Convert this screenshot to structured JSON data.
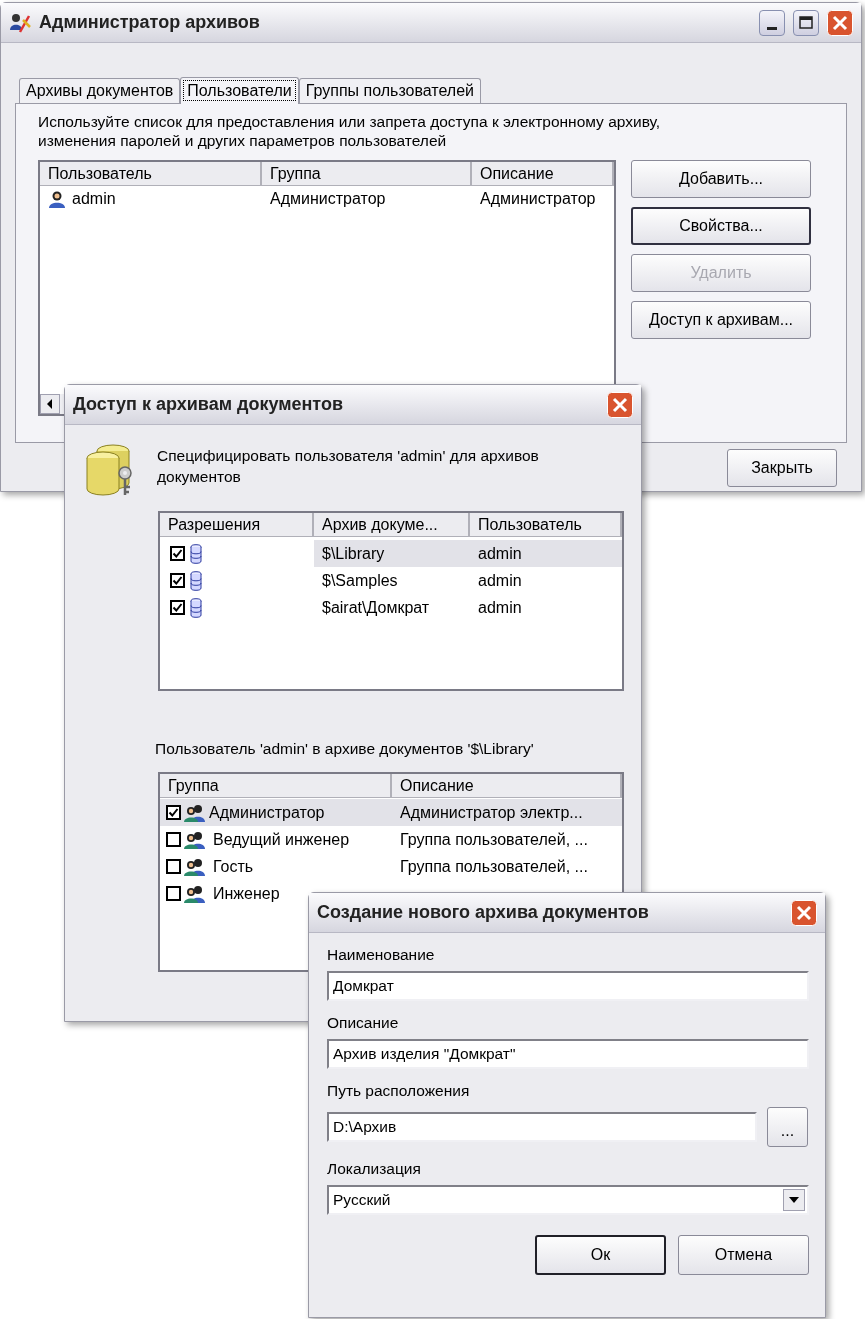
{
  "main_window": {
    "title": "Администратор архивов",
    "tabs": [
      {
        "label": "Архивы документов",
        "selected": false
      },
      {
        "label": "Пользователи",
        "selected": true
      },
      {
        "label": "Группы пользователей",
        "selected": false
      }
    ],
    "instruction": "Используйте список для предоставления или запрета доступа к электронному архиву, изменения паролей и других параметров пользователей",
    "users_table": {
      "columns": [
        "Пользователь",
        "Группа",
        "Описание"
      ],
      "rows": [
        {
          "cells": [
            "admin",
            "Администратор",
            "Администратор"
          ]
        }
      ]
    },
    "buttons": [
      {
        "label": "Добавить...",
        "disabled": false,
        "default": false
      },
      {
        "label": "Свойства...",
        "disabled": false,
        "default": true
      },
      {
        "label": "Удалить",
        "disabled": true,
        "default": false
      },
      {
        "label": "Доступ к архивам...",
        "disabled": false,
        "default": false
      }
    ],
    "close_button": "Закрыть"
  },
  "access_dialog": {
    "title": "Доступ к архивам документов",
    "prompt": "Специфицировать пользователя 'admin' для архивов документов",
    "archives_table": {
      "columns": [
        "Разрешения",
        "Архив докуме...",
        "Пользователь"
      ],
      "rows": [
        {
          "checked": true,
          "selected": true,
          "archive": "$\\Library",
          "user": "admin"
        },
        {
          "checked": true,
          "selected": false,
          "archive": "$\\Samples",
          "user": "admin"
        },
        {
          "checked": true,
          "selected": false,
          "archive": "$airat\\Домкрат",
          "user": "admin"
        }
      ]
    },
    "groups_label": "Пользователь 'admin' в архиве документов '$\\Library'",
    "groups_table": {
      "columns": [
        "Группа",
        "Описание"
      ],
      "rows": [
        {
          "checked": true,
          "selected": true,
          "name": "Администратор",
          "description": "Администратор электр..."
        },
        {
          "checked": false,
          "selected": false,
          "name": "Ведущий инженер",
          "description": "Группа пользователей, ..."
        },
        {
          "checked": false,
          "selected": false,
          "name": "Гость",
          "description": "Группа пользователей, ..."
        },
        {
          "checked": false,
          "selected": false,
          "name": "Инженер"
        }
      ]
    }
  },
  "create_dialog": {
    "title": "Создание нового архива документов",
    "fields": [
      {
        "kind": "text",
        "label": "Наименование",
        "value": "Домкрат"
      },
      {
        "kind": "text",
        "label": "Описание",
        "value": "Архив изделия \"Домкрат\""
      },
      {
        "kind": "path",
        "label": "Путь расположения",
        "value": "D:\\Архив",
        "browse": "..."
      },
      {
        "kind": "select",
        "label": "Локализация",
        "value": "Русский"
      }
    ],
    "buttons": [
      {
        "label": "Ок",
        "default": true
      },
      {
        "label": "Отмена",
        "default": false
      }
    ]
  }
}
